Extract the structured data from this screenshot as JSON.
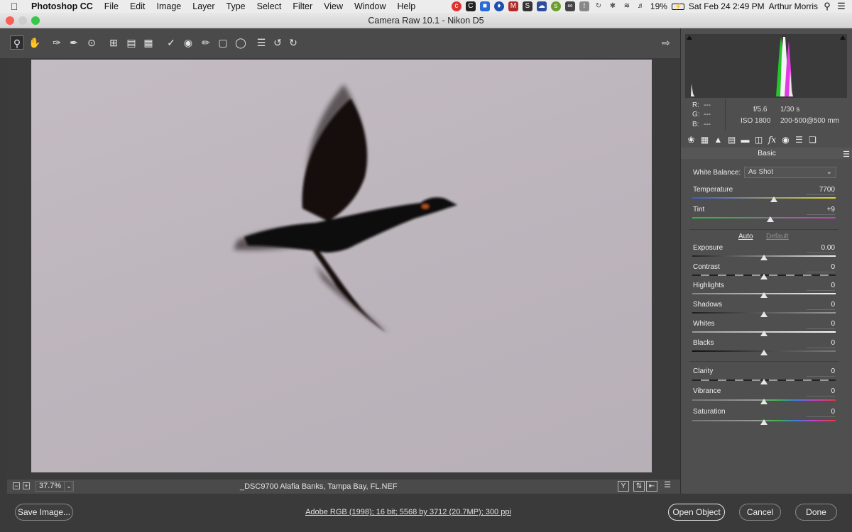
{
  "menubar": {
    "apple_icon": "apple-icon",
    "app_name": "Photoshop CC",
    "items": [
      "File",
      "Edit",
      "Image",
      "Layer",
      "Type",
      "Select",
      "Filter",
      "View",
      "Window",
      "Help"
    ],
    "battery": "19%",
    "datetime": "Sat Feb 24  2:49 PM",
    "user": "Arthur Morris"
  },
  "window": {
    "title": "Camera Raw 10.1  -  Nikon D5"
  },
  "status": {
    "zoom": "37.7%",
    "filename": "_DSC9700  Alafia Banks, Tampa Bay, FL.NEF"
  },
  "readout": {
    "r_label": "R:",
    "r_value": "---",
    "g_label": "G:",
    "g_value": "---",
    "b_label": "B:",
    "b_value": "---",
    "aperture": "f/5.6",
    "shutter": "1/30 s",
    "iso": "ISO 1800",
    "lens": "200-500@500 mm"
  },
  "panel": {
    "section_title": "Basic",
    "white_balance_label": "White Balance:",
    "white_balance_value": "As Shot",
    "auto_label": "Auto",
    "default_label": "Default",
    "sliders": {
      "temperature": {
        "label": "Temperature",
        "value": "7700",
        "level": 0.57
      },
      "tint": {
        "label": "Tint",
        "value": "+9",
        "level": 0.545
      },
      "exposure": {
        "label": "Exposure",
        "value": "0.00",
        "level": 0.5
      },
      "contrast": {
        "label": "Contrast",
        "value": "0",
        "level": 0.5
      },
      "highlights": {
        "label": "Highlights",
        "value": "0",
        "level": 0.5
      },
      "shadows": {
        "label": "Shadows",
        "value": "0",
        "level": 0.5
      },
      "whites": {
        "label": "Whites",
        "value": "0",
        "level": 0.5
      },
      "blacks": {
        "label": "Blacks",
        "value": "0",
        "level": 0.5
      },
      "clarity": {
        "label": "Clarity",
        "value": "0",
        "level": 0.5
      },
      "vibrance": {
        "label": "Vibrance",
        "value": "0",
        "level": 0.5
      },
      "saturation": {
        "label": "Saturation",
        "value": "0",
        "level": 0.5
      }
    }
  },
  "footer": {
    "save_label": "Save Image...",
    "workflow_text": "Adobe RGB (1998); 16 bit; 5568 by 3712 (20.7MP); 300 ppi",
    "open_label": "Open Object",
    "cancel_label": "Cancel",
    "done_label": "Done"
  },
  "colors": {
    "accent": "#e8e8e8",
    "temperature_track_start": "#3c5ad6",
    "temperature_track_end": "#e1d52a",
    "tint_track_start": "#2bbd3a",
    "tint_track_end": "#c53cc4"
  }
}
